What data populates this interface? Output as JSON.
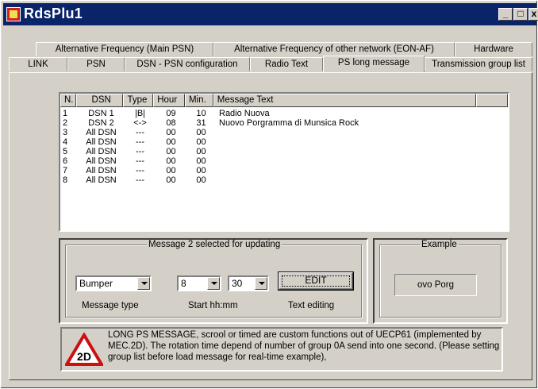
{
  "window": {
    "title": "RdsPlu1",
    "min_glyph": "_",
    "max_glyph": "□",
    "close_glyph": "x"
  },
  "tabs": {
    "row1": [
      "Alternative Frequency (Main PSN)",
      "Alternative Frequency of other network (EON-AF)",
      "Hardware"
    ],
    "row2": [
      "LINK",
      "PSN",
      "DSN - PSN configuration",
      "Radio Text",
      "PS long message",
      "Transmission group list"
    ],
    "active": "PS long message"
  },
  "list": {
    "columns": [
      "N.",
      "DSN",
      "Type",
      "Hour",
      "Min.",
      "Message Text"
    ],
    "rows": [
      [
        "1",
        "DSN 1",
        "|B|",
        "09",
        "10",
        "Radio  Nuova"
      ],
      [
        "2",
        "DSN 2",
        "<->",
        "08",
        "31",
        "Nuovo Porgramma di Munsica Rock"
      ],
      [
        "3",
        "All DSN",
        "---",
        "00",
        "00",
        ""
      ],
      [
        "4",
        "All DSN",
        "---",
        "00",
        "00",
        ""
      ],
      [
        "5",
        "All DSN",
        "---",
        "00",
        "00",
        ""
      ],
      [
        "6",
        "All DSN",
        "---",
        "00",
        "00",
        ""
      ],
      [
        "7",
        "All DSN",
        "---",
        "00",
        "00",
        ""
      ],
      [
        "8",
        "All DSN",
        "---",
        "00",
        "00",
        ""
      ]
    ]
  },
  "update_group": {
    "title": "Message 2 selected for updating",
    "message_type_value": "Bumper",
    "hour_value": "8",
    "minute_value": "30",
    "edit_label": "EDIT",
    "message_type_label": "Message type",
    "start_label": "Start  hh:mm",
    "text_editing_label": "Text editing"
  },
  "example_group": {
    "title": "Example",
    "value": "ovo Porg"
  },
  "info": {
    "badge_text": "2D",
    "text": "LONG PS MESSAGE, scrool or timed are custom functions out of UECP61 (implemented by MEC.2D).  The rotation time depend of number of group 0A send into one second. (Please setting group list before load message for real-time example),"
  },
  "colors": {
    "titlebar": "#0a246a",
    "face": "#d4d0c8",
    "badge_red": "#cc1010"
  }
}
